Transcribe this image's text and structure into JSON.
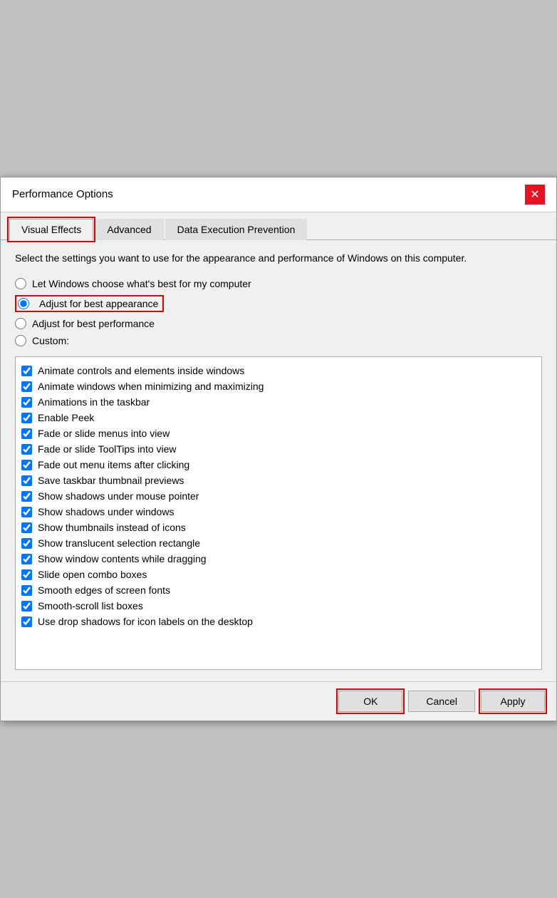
{
  "dialog": {
    "title": "Performance Options",
    "close_label": "✕"
  },
  "tabs": [
    {
      "id": "visual-effects",
      "label": "Visual Effects",
      "active": true
    },
    {
      "id": "advanced",
      "label": "Advanced",
      "active": false
    },
    {
      "id": "dep",
      "label": "Data Execution Prevention",
      "active": false
    }
  ],
  "content": {
    "description": "Select the settings you want to use for the appearance and performance of Windows on this computer.",
    "radio_options": [
      {
        "id": "windows-best",
        "label": "Let Windows choose what's best for my computer",
        "checked": false
      },
      {
        "id": "best-appearance",
        "label": "Adjust for best appearance",
        "checked": true
      },
      {
        "id": "best-performance",
        "label": "Adjust for best performance",
        "checked": false
      },
      {
        "id": "custom",
        "label": "Custom:",
        "checked": false
      }
    ],
    "checkboxes": [
      {
        "id": "animate-controls",
        "label": "Animate controls and elements inside windows",
        "checked": true
      },
      {
        "id": "animate-windows",
        "label": "Animate windows when minimizing and maximizing",
        "checked": true
      },
      {
        "id": "animations-taskbar",
        "label": "Animations in the taskbar",
        "checked": true
      },
      {
        "id": "enable-peek",
        "label": "Enable Peek",
        "checked": true
      },
      {
        "id": "fade-slide-menus",
        "label": "Fade or slide menus into view",
        "checked": true
      },
      {
        "id": "fade-slide-tooltips",
        "label": "Fade or slide ToolTips into view",
        "checked": true
      },
      {
        "id": "fade-out-menu",
        "label": "Fade out menu items after clicking",
        "checked": true
      },
      {
        "id": "save-taskbar",
        "label": "Save taskbar thumbnail previews",
        "checked": true
      },
      {
        "id": "shadows-mouse",
        "label": "Show shadows under mouse pointer",
        "checked": true
      },
      {
        "id": "shadows-windows",
        "label": "Show shadows under windows",
        "checked": true
      },
      {
        "id": "show-thumbnails",
        "label": "Show thumbnails instead of icons",
        "checked": true
      },
      {
        "id": "translucent-selection",
        "label": "Show translucent selection rectangle",
        "checked": true
      },
      {
        "id": "window-contents",
        "label": "Show window contents while dragging",
        "checked": true
      },
      {
        "id": "slide-combo",
        "label": "Slide open combo boxes",
        "checked": true
      },
      {
        "id": "smooth-edges",
        "label": "Smooth edges of screen fonts",
        "checked": true
      },
      {
        "id": "smooth-scroll",
        "label": "Smooth-scroll list boxes",
        "checked": true
      },
      {
        "id": "drop-shadows",
        "label": "Use drop shadows for icon labels on the desktop",
        "checked": true
      }
    ]
  },
  "footer": {
    "ok_label": "OK",
    "cancel_label": "Cancel",
    "apply_label": "Apply"
  }
}
